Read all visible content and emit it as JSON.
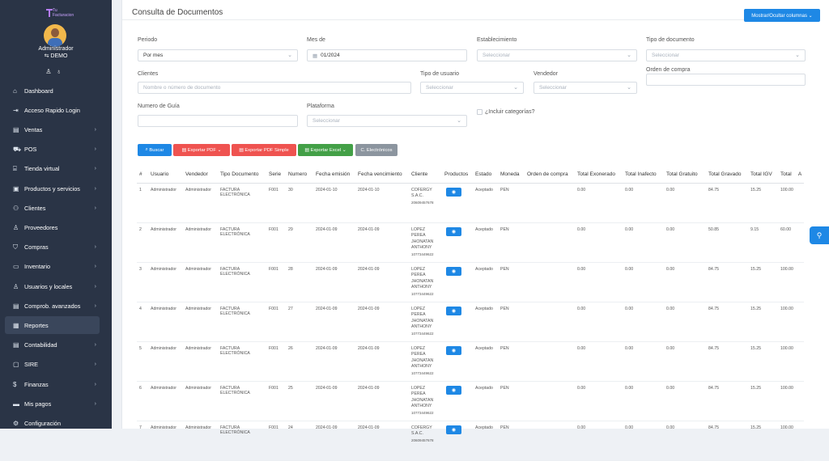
{
  "brand": {
    "name": "Tu Facturacion"
  },
  "user": {
    "name": "Administrador",
    "company": "DEMO"
  },
  "sidebar": {
    "items": [
      {
        "label": "Dashboard",
        "icon": "dashboard-icon",
        "chev": ""
      },
      {
        "label": "Acceso Rapido Login",
        "icon": "login-icon",
        "chev": ""
      },
      {
        "label": "Ventas",
        "icon": "invoice-icon",
        "chev": "›"
      },
      {
        "label": "POS",
        "icon": "cart-icon",
        "chev": "›"
      },
      {
        "label": "Tienda virtual",
        "icon": "store-icon",
        "chev": "›"
      },
      {
        "label": "Productos y servicios",
        "icon": "box-icon",
        "chev": "›"
      },
      {
        "label": "Clientes",
        "icon": "users-icon",
        "chev": "›"
      },
      {
        "label": "Proveedores",
        "icon": "user-icon",
        "chev": ""
      },
      {
        "label": "Compras",
        "icon": "bag-icon",
        "chev": "›"
      },
      {
        "label": "Inventario",
        "icon": "book-icon",
        "chev": "›"
      },
      {
        "label": "Usuarios y locales",
        "icon": "person-icon",
        "chev": "›"
      },
      {
        "label": "Comprob. avanzados",
        "icon": "doc-icon",
        "chev": "›"
      },
      {
        "label": "Reportes",
        "icon": "report-icon",
        "chev": ""
      },
      {
        "label": "Contabilidad",
        "icon": "ledger-icon",
        "chev": "›"
      },
      {
        "label": "SIRE",
        "icon": "sire-icon",
        "chev": "›"
      },
      {
        "label": "Finanzas",
        "icon": "money-icon",
        "chev": "›"
      },
      {
        "label": "Mis pagos",
        "icon": "card-icon",
        "chev": "›"
      },
      {
        "label": "Configuración",
        "icon": "gear-icon",
        "chev": ""
      }
    ]
  },
  "page": {
    "title": "Consulta de Documentos",
    "columns_button": "Mostrar/Ocultar columnas ⌄"
  },
  "filters": {
    "periodo": {
      "label": "Periodo",
      "value": "Por mes"
    },
    "mes": {
      "label": "Mes de",
      "value": "01/2024"
    },
    "establecimiento": {
      "label": "Establecimiento",
      "placeholder": "Seleccionar"
    },
    "tipo_documento": {
      "label": "Tipo de documento",
      "placeholder": "Seleccionar"
    },
    "clientes": {
      "label": "Clientes",
      "placeholder": "Nombre o número de documento"
    },
    "tipo_usuario": {
      "label": "Tipo de usuario",
      "placeholder": "Seleccionar"
    },
    "vendedor": {
      "label": "Vendedor",
      "placeholder": "Seleccionar"
    },
    "orden_compra": {
      "label": "Orden de compra",
      "value": ""
    },
    "numero_guia": {
      "label": "Numero de Guía",
      "value": ""
    },
    "plataforma": {
      "label": "Plataforma",
      "placeholder": "Seleccionar"
    },
    "incluir_categorias": {
      "label": "¿Incluir categorías?"
    }
  },
  "actions": {
    "buscar": "Buscar",
    "pdf": "Exportar PDF ⌄",
    "pdf_simple": "Exportar PDF Simple",
    "excel": "Exportar Excel ⌄",
    "electronicos": "C. Electrónicos"
  },
  "table": {
    "headers": [
      "#",
      "Usuario",
      "Vendedor",
      "Tipo Documento",
      "Serie",
      "Numero",
      "Fecha emisión",
      "Fecha vencimiento",
      "Cliente",
      "Productos",
      "Estado",
      "Moneda",
      "Orden de compra",
      "Total Exonerado",
      "Total Inafecto",
      "Total Gratuito",
      "Total Gravado",
      "Total IGV",
      "Total",
      "A"
    ],
    "rows": [
      {
        "n": "1",
        "usuario": "Administrador",
        "vendedor": "Administrador",
        "tipo": "FACTURA ELECTRÓNICA",
        "serie": "F001",
        "numero": "30",
        "emision": "2024-01-10",
        "venc": "2024-01-10",
        "cliente": "COFERGY S.A.C.",
        "doc": "20609457678",
        "estado": "Aceptado",
        "moneda": "PEN",
        "orden": "",
        "exon": "0.00",
        "inaf": "0.00",
        "grat": "0.00",
        "grav": "84.75",
        "igv": "15.25",
        "total": "100.00"
      },
      {
        "n": "2",
        "usuario": "Administrador",
        "vendedor": "Administrador",
        "tipo": "FACTURA ELECTRÓNICA",
        "serie": "F001",
        "numero": "29",
        "emision": "2024-01-09",
        "venc": "2024-01-09",
        "cliente": "LOPEZ PEREA JHONATAN ANTHONY",
        "doc": "10773449622",
        "estado": "Aceptado",
        "moneda": "PEN",
        "orden": "",
        "exon": "0.00",
        "inaf": "0.00",
        "grat": "0.00",
        "grav": "50.85",
        "igv": "9.15",
        "total": "60.00"
      },
      {
        "n": "3",
        "usuario": "Administrador",
        "vendedor": "Administrador",
        "tipo": "FACTURA ELECTRÓNICA",
        "serie": "F001",
        "numero": "28",
        "emision": "2024-01-09",
        "venc": "2024-01-09",
        "cliente": "LOPEZ PEREA JHONATAN ANTHONY",
        "doc": "10773449622",
        "estado": "Aceptado",
        "moneda": "PEN",
        "orden": "",
        "exon": "0.00",
        "inaf": "0.00",
        "grat": "0.00",
        "grav": "84.75",
        "igv": "15.25",
        "total": "100.00"
      },
      {
        "n": "4",
        "usuario": "Administrador",
        "vendedor": "Administrador",
        "tipo": "FACTURA ELECTRÓNICA",
        "serie": "F001",
        "numero": "27",
        "emision": "2024-01-09",
        "venc": "2024-01-09",
        "cliente": "LOPEZ PEREA JHONATAN ANTHONY",
        "doc": "10773449622",
        "estado": "Aceptado",
        "moneda": "PEN",
        "orden": "",
        "exon": "0.00",
        "inaf": "0.00",
        "grat": "0.00",
        "grav": "84.75",
        "igv": "15.25",
        "total": "100.00"
      },
      {
        "n": "5",
        "usuario": "Administrador",
        "vendedor": "Administrador",
        "tipo": "FACTURA ELECTRÓNICA",
        "serie": "F001",
        "numero": "26",
        "emision": "2024-01-09",
        "venc": "2024-01-09",
        "cliente": "LOPEZ PEREA JHONATAN ANTHONY",
        "doc": "10773449622",
        "estado": "Aceptado",
        "moneda": "PEN",
        "orden": "",
        "exon": "0.00",
        "inaf": "0.00",
        "grat": "0.00",
        "grav": "84.75",
        "igv": "15.25",
        "total": "100.00"
      },
      {
        "n": "6",
        "usuario": "Administrador",
        "vendedor": "Administrador",
        "tipo": "FACTURA ELECTRÓNICA",
        "serie": "F001",
        "numero": "25",
        "emision": "2024-01-09",
        "venc": "2024-01-09",
        "cliente": "LOPEZ PEREA JHONATAN ANTHONY",
        "doc": "10773449622",
        "estado": "Aceptado",
        "moneda": "PEN",
        "orden": "",
        "exon": "0.00",
        "inaf": "0.00",
        "grat": "0.00",
        "grav": "84.75",
        "igv": "15.25",
        "total": "100.00"
      },
      {
        "n": "7",
        "usuario": "Administrador",
        "vendedor": "Administrador",
        "tipo": "FACTURA ELECTRÓNICA",
        "serie": "F001",
        "numero": "24",
        "emision": "2024-01-09",
        "venc": "2024-01-09",
        "cliente": "COFERGY S.A.C.",
        "doc": "20609457678",
        "estado": "Aceptado",
        "moneda": "PEN",
        "orden": "",
        "exon": "0.00",
        "inaf": "0.00",
        "grat": "0.00",
        "grav": "84.75",
        "igv": "15.25",
        "total": "100.00"
      }
    ]
  },
  "colors": {
    "sidebar": "#2a3446",
    "primary": "#1e88e5",
    "danger": "#ef5350",
    "success": "#43a047",
    "secondary": "#8c959f"
  }
}
